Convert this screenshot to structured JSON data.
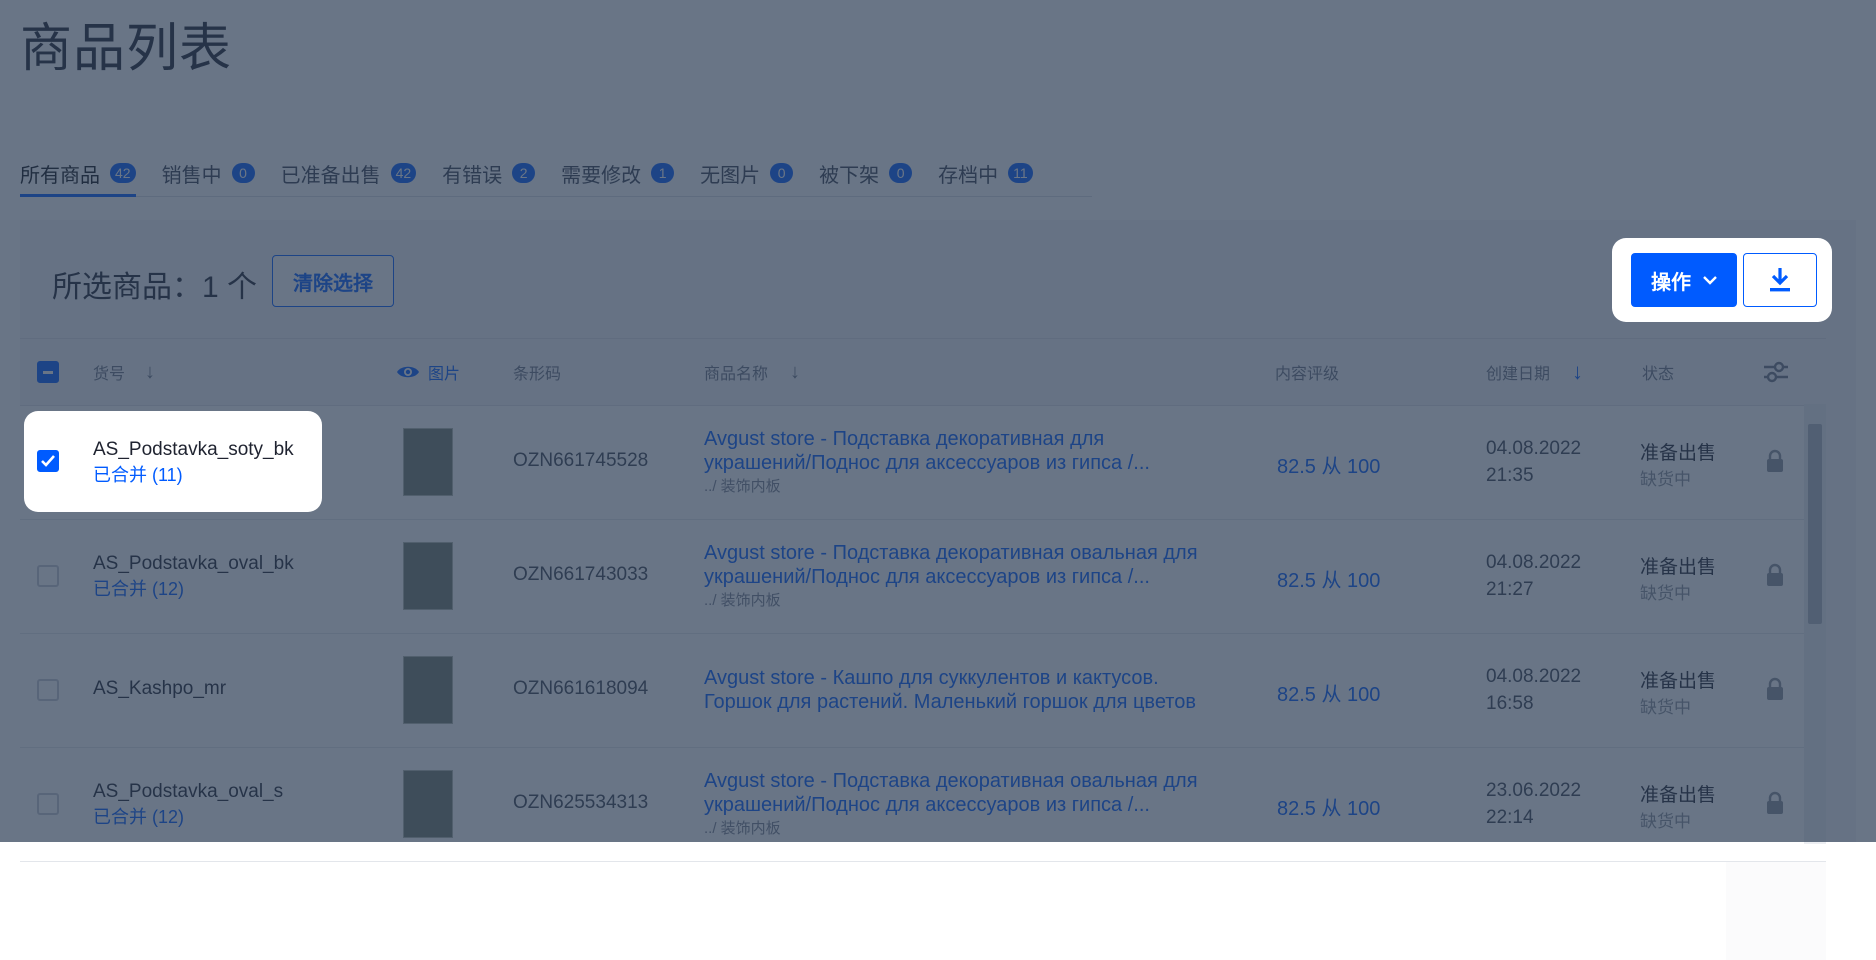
{
  "page": {
    "title": "商品列表"
  },
  "tabs": [
    {
      "label": "所有商品",
      "count": "42"
    },
    {
      "label": "销售中",
      "count": "0"
    },
    {
      "label": "已准备出售",
      "count": "42"
    },
    {
      "label": "有错误",
      "count": "2"
    },
    {
      "label": "需要修改",
      "count": "1"
    },
    {
      "label": "无图片",
      "count": "0"
    },
    {
      "label": "被下架",
      "count": "0"
    },
    {
      "label": "存档中",
      "count": "11"
    }
  ],
  "selection": {
    "text": "所选商品：1 个",
    "clear_label": "清除选择"
  },
  "toolbar": {
    "operate_label": "操作"
  },
  "columns": {
    "sku": "货号",
    "image": "图片",
    "barcode": "条形码",
    "name": "商品名称",
    "rating": "内容评级",
    "created": "创建日期",
    "status": "状态"
  },
  "rows": [
    {
      "sku": "AS_Podstavka_soty_bk",
      "merged": "已合并 (11)",
      "barcode": "OZN661745528",
      "name_line1": "Avgust store - Подставка декоративная для",
      "name_line2": "украшений/Поднос для аксессуаров из гипса /...",
      "category": "../ 装饰内板",
      "rating": "82.5 从 100",
      "date": "04.08.2022",
      "time": "21:35",
      "status": "准备出售",
      "substatus": "缺货中",
      "checked": true
    },
    {
      "sku": "AS_Podstavka_oval_bk",
      "merged": "已合并 (12)",
      "barcode": "OZN661743033",
      "name_line1": "Avgust store - Подставка декоративная овальная для",
      "name_line2": "украшений/Поднос для аксессуаров из гипса /...",
      "category": "../ 装饰内板",
      "rating": "82.5 从 100",
      "date": "04.08.2022",
      "time": "21:27",
      "status": "准备出售",
      "substatus": "缺货中",
      "checked": false
    },
    {
      "sku": "AS_Kashpo_mr",
      "merged": "",
      "barcode": "OZN661618094",
      "name_line1": "Avgust store - Кашпо для суккулентов и кактусов.",
      "name_line2": "Горшок для растений. Маленький горшок для цветов",
      "category": "",
      "rating": "82.5 从 100",
      "date": "04.08.2022",
      "time": "16:58",
      "status": "准备出售",
      "substatus": "缺货中",
      "checked": false
    },
    {
      "sku": "AS_Podstavka_oval_s",
      "merged": "已合并 (12)",
      "barcode": "OZN625534313",
      "name_line1": "Avgust store - Подставка декоративная овальная для",
      "name_line2": "украшений/Поднос для аксессуаров из гипса /...",
      "category": "../ 装饰内板",
      "rating": "82.5 从 100",
      "date": "23.06.2022",
      "time": "22:14",
      "status": "准备出售",
      "substatus": "缺货中",
      "checked": false
    }
  ],
  "colors": {
    "accent": "#005bff",
    "overlay": "rgba(42,58,82,0.70)"
  }
}
